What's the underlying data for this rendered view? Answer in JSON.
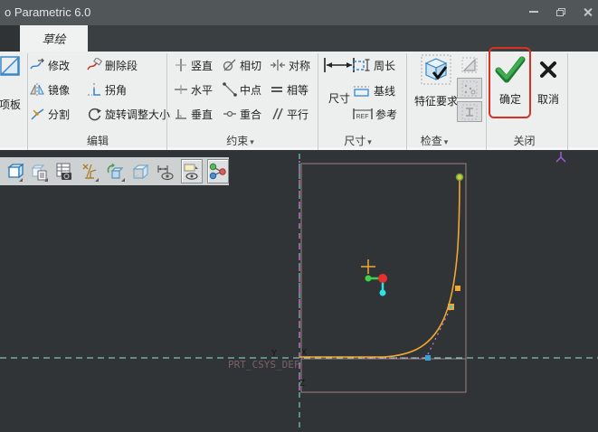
{
  "window": {
    "title": "o Parametric 6.0"
  },
  "tab_bar": {
    "active_tab": "草绘",
    "search_value": ""
  },
  "icons": {
    "dropdown_arrow": "▾",
    "caret_down": "▾",
    "help_glyph": "?",
    "ref_glyph": "REF"
  },
  "ribbon": {
    "palette": {
      "label": "项板"
    },
    "edit": {
      "label": "编辑",
      "modify": "修改",
      "delete_segment": "删除段",
      "mirror": "镜像",
      "corner": "拐角",
      "divide": "分割",
      "rotate_resize": "旋转调整大小"
    },
    "constraints": {
      "label": "约束",
      "vertical": "竖直",
      "tangent": "相切",
      "symmetric": "对称",
      "horizontal": "水平",
      "midpoint": "中点",
      "equal": "相等",
      "perpendicular": "垂直",
      "coincident": "重合",
      "parallel": "平行"
    },
    "dimension": {
      "label": "尺寸",
      "dimension_btn": "尺寸",
      "perimeter": "周长",
      "baseline": "基线",
      "reference": "参考"
    },
    "inspect": {
      "label": "检查",
      "feature_requirements": "特征要求"
    },
    "close": {
      "label": "关闭",
      "ok": "确定",
      "cancel": "取消"
    }
  },
  "canvas": {
    "csys_label": "PRT_CSYS_DEF",
    "axis_x": "X",
    "axis_y": "Y",
    "axis_z": "Z"
  },
  "colors": {
    "annotation_red": "#d93025",
    "check_green": "#2f9e44",
    "spline_yellow": "#f0a832",
    "centerline_cyan": "#8ce8d4",
    "centerline_magenta": "#c478c4",
    "section_rose": "#9c8184",
    "accent_blue": "#3a87c8"
  }
}
